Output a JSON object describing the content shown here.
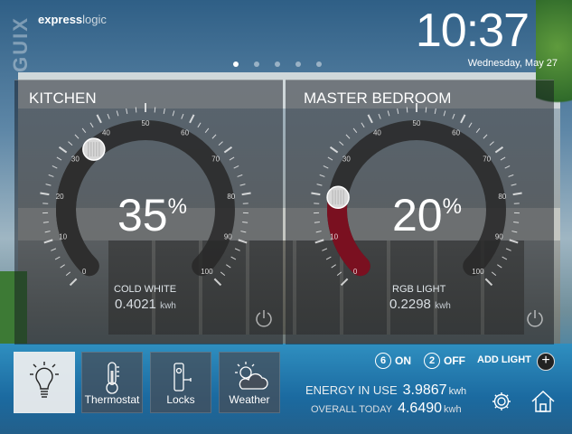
{
  "brand": {
    "vertical": "GUIX",
    "express": "express",
    "logic": "logic"
  },
  "clock": {
    "time": "10:37",
    "date": "Wednesday, May 27"
  },
  "pager": {
    "count": 5,
    "active": 0
  },
  "rooms": [
    {
      "name": "KITCHEN",
      "percent": "35",
      "percent_sign": "%",
      "percent_value": 35,
      "light_type": "COLD WHITE",
      "energy": "0.4021",
      "energy_unit": "kwh",
      "arc_color": "#2e2e2e"
    },
    {
      "name": "MASTER BEDROOM",
      "percent": "20",
      "percent_sign": "%",
      "percent_value": 20,
      "light_type": "RGB LIGHT",
      "energy": "0.2298",
      "energy_unit": "kwh",
      "arc_color": "#7a1020"
    }
  ],
  "dial_ticks": [
    "0",
    "10",
    "20",
    "30",
    "40",
    "50",
    "60",
    "70",
    "80",
    "90",
    "100"
  ],
  "tiles": [
    {
      "label": "",
      "icon": "lightbulb-icon",
      "active": true
    },
    {
      "label": "Thermostat",
      "icon": "thermometer-icon",
      "active": false
    },
    {
      "label": "Locks",
      "icon": "lock-icon",
      "active": false
    },
    {
      "label": "Weather",
      "icon": "weather-icon",
      "active": false
    }
  ],
  "status": {
    "on_count": "6",
    "on_label": "ON",
    "off_count": "2",
    "off_label": "OFF",
    "add_label": "ADD LIGHT",
    "add_symbol": "+"
  },
  "energy": {
    "in_use_label": "ENERGY IN USE",
    "in_use_value": "3.9867",
    "in_use_unit": "kwh",
    "overall_label": "OVERALL TODAY",
    "overall_value": "4.6490",
    "overall_unit": "kwh"
  },
  "colors": {
    "accent": "#ffffff",
    "arc_track": "#2e2e2e",
    "rgb_arc": "#7a1020"
  }
}
